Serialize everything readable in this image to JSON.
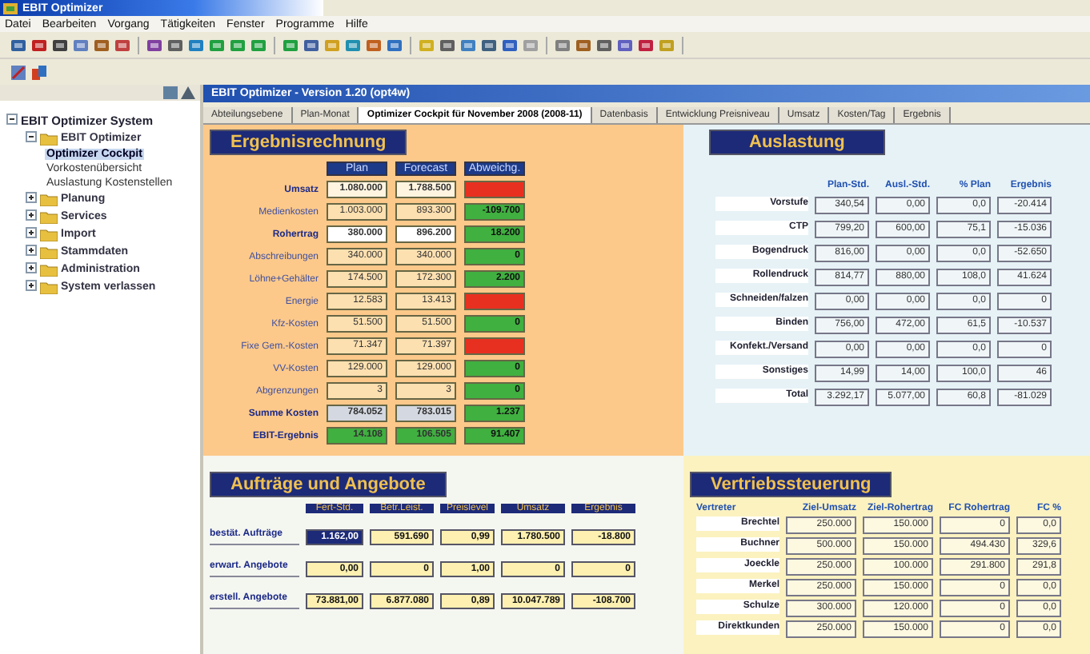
{
  "window": {
    "title": "EBIT Optimizer"
  },
  "menu": [
    "Datei",
    "Bearbeiten",
    "Vorgang",
    "Tätigkeiten",
    "Fenster",
    "Programme",
    "Hilfe"
  ],
  "sidebar": {
    "items": [
      {
        "label": "EBIT Optimizer System",
        "expanded": true,
        "children": [
          {
            "label": "EBIT Optimizer",
            "expanded": true,
            "children": [
              {
                "label": "Optimizer Cockpit",
                "selected": true
              },
              {
                "label": "Vorkostenübersicht",
                "selected": false
              },
              {
                "label": "Auslastung Kostenstellen",
                "selected": false
              }
            ]
          },
          {
            "label": "Planung",
            "expanded": false
          },
          {
            "label": "Services",
            "expanded": false
          },
          {
            "label": "Import",
            "expanded": false
          },
          {
            "label": "Stammdaten",
            "expanded": false
          },
          {
            "label": "Administration",
            "expanded": false
          },
          {
            "label": "System verlassen",
            "expanded": false
          }
        ]
      }
    ]
  },
  "inner_window": {
    "title": "EBIT Optimizer - Version 1.20 (opt4w)"
  },
  "tabs": [
    {
      "label": "Abteilungsebene",
      "selected": false
    },
    {
      "label": "Plan-Monat",
      "selected": false
    },
    {
      "label": "Optimizer Cockpit für November 2008 (2008-11)",
      "selected": true
    },
    {
      "label": "Datenbasis",
      "selected": false
    },
    {
      "label": "Entwicklung Preisniveau",
      "selected": false
    },
    {
      "label": "Umsatz",
      "selected": false
    },
    {
      "label": "Kosten/Tag",
      "selected": false
    },
    {
      "label": "Ergebnis",
      "selected": false
    }
  ],
  "ergebnis": {
    "title": "Ergebnisrechnung",
    "columns": [
      "Plan",
      "Forecast",
      "Abweichg."
    ],
    "rows": [
      {
        "kind": "bold",
        "label": "Umsatz",
        "plan": "1.080.000",
        "forecast": "1.788.500",
        "color": "#e83020"
      },
      {
        "kind": "normal",
        "label": "Medienkosten",
        "plan": "1.003.000",
        "forecast": "893.300",
        "deviation": "-109.700",
        "color": "#40b040"
      },
      {
        "kind": "highlight",
        "label": "Rohertrag",
        "plan": "380.000",
        "forecast": "896.200",
        "deviation": "18.200",
        "color": "#40b040"
      },
      {
        "kind": "normal",
        "label": "Abschreibungen",
        "plan": "340.000",
        "forecast": "340.000",
        "deviation": "0",
        "color": "#40b040"
      },
      {
        "kind": "normal",
        "label": "Löhne+Gehälter",
        "plan": "174.500",
        "forecast": "172.300",
        "deviation": "2.200",
        "color": "#40b040"
      },
      {
        "kind": "normal",
        "label": "Energie",
        "plan": "12.583",
        "forecast": "13.413",
        "color": "#e83020"
      },
      {
        "kind": "normal",
        "label": "Kfz-Kosten",
        "plan": "51.500",
        "forecast": "51.500",
        "deviation": "0",
        "color": "#40b040"
      },
      {
        "kind": "normal",
        "label": "Fixe Gem.-Kosten",
        "plan": "71.347",
        "forecast": "71.397",
        "color": "#e83020"
      },
      {
        "kind": "normal",
        "label": "VV-Kosten",
        "plan": "129.000",
        "forecast": "129.000",
        "deviation": "0",
        "color": "#40b040"
      },
      {
        "kind": "normal",
        "label": "Abgrenzungen",
        "plan": "3",
        "forecast": "3",
        "deviation": "0",
        "color": "#40b040"
      },
      {
        "kind": "total",
        "label": "Summe Kosten",
        "plan": "784.052",
        "forecast": "783.015",
        "deviation": "1.237",
        "color": "#40b040"
      },
      {
        "kind": "result",
        "label": "EBIT-Ergebnis",
        "plan": "14.108",
        "forecast": "106.505",
        "deviation": "91.407",
        "color": "#40b040"
      }
    ]
  },
  "auslastung": {
    "title": "Auslastung",
    "columns": [
      "Plan-Std.",
      "Ausl.-Std.",
      "% Plan",
      "Ergebnis"
    ],
    "rows": [
      {
        "label": "Vorstufe",
        "values": [
          "340,54",
          "0,00",
          "0,0",
          "-20.414"
        ]
      },
      {
        "label": "CTP",
        "values": [
          "799,20",
          "600,00",
          "75,1",
          "-15.036"
        ]
      },
      {
        "label": "Bogendruck",
        "values": [
          "816,00",
          "0,00",
          "0,0",
          "-52.650"
        ]
      },
      {
        "label": "Rollendruck",
        "values": [
          "814,77",
          "880,00",
          "108,0",
          "41.624"
        ]
      },
      {
        "label": "Schneiden/falzen",
        "values": [
          "0,00",
          "0,00",
          "0,0",
          "0"
        ]
      },
      {
        "label": "Binden",
        "values": [
          "756,00",
          "472,00",
          "61,5",
          "-10.537"
        ]
      },
      {
        "label": "Konfekt./Versand",
        "values": [
          "0,00",
          "0,00",
          "0,0",
          "0"
        ]
      },
      {
        "label": "Sonstiges",
        "values": [
          "14,99",
          "14,00",
          "100,0",
          "46"
        ]
      },
      {
        "label": "Total",
        "values": [
          "3.292,17",
          "5.077,00",
          "60,8",
          "-81.029"
        ]
      }
    ]
  },
  "auftraege": {
    "title": "Aufträge und Angebote",
    "columns": [
      "Fert-Std.",
      "Betr.Leist.",
      "Preislevel",
      "Umsatz",
      "Ergebnis"
    ],
    "rows": [
      {
        "label": "bestät. Aufträge",
        "values": [
          {
            "text": "1.162,00",
            "selected": true
          },
          {
            "text": "591.690",
            "selected": false
          },
          {
            "text": "0,99",
            "selected": false
          },
          {
            "text": "1.780.500",
            "selected": false
          },
          {
            "text": "-18.800",
            "selected": false
          }
        ]
      },
      {
        "label": "erwart. Angebote",
        "values": [
          {
            "text": "0,00",
            "selected": false
          },
          {
            "text": "0",
            "selected": false
          },
          {
            "text": "1,00",
            "selected": false
          },
          {
            "text": "0",
            "selected": false
          },
          {
            "text": "0",
            "selected": false
          }
        ]
      },
      {
        "label": "erstell. Angebote",
        "values": [
          {
            "text": "73.881,00",
            "selected": false
          },
          {
            "text": "6.877.080",
            "selected": false
          },
          {
            "text": "0,89",
            "selected": false
          },
          {
            "text": "10.047.789",
            "selected": false
          },
          {
            "text": "-108.700",
            "selected": false
          }
        ]
      }
    ]
  },
  "vertrieb": {
    "title": "Vertriebssteuerung",
    "columns": [
      "Vertreter",
      "Ziel-Umsatz",
      "Ziel-Rohertrag",
      "FC Rohertrag",
      "FC %"
    ],
    "rows": [
      {
        "label": "Brechtel",
        "values": [
          "250.000",
          "150.000",
          "0",
          "0,0"
        ]
      },
      {
        "label": "Buchner",
        "values": [
          "500.000",
          "150.000",
          "494.430",
          "329,6"
        ]
      },
      {
        "label": "Joeckle",
        "values": [
          "250.000",
          "100.000",
          "291.800",
          "291,8"
        ]
      },
      {
        "label": "Merkel",
        "values": [
          "250.000",
          "150.000",
          "0",
          "0,0"
        ]
      },
      {
        "label": "Schulze",
        "values": [
          "300.000",
          "120.000",
          "0",
          "0,0"
        ]
      },
      {
        "label": "Direktkunden",
        "values": [
          "250.000",
          "150.000",
          "0",
          "0,0"
        ]
      }
    ]
  }
}
